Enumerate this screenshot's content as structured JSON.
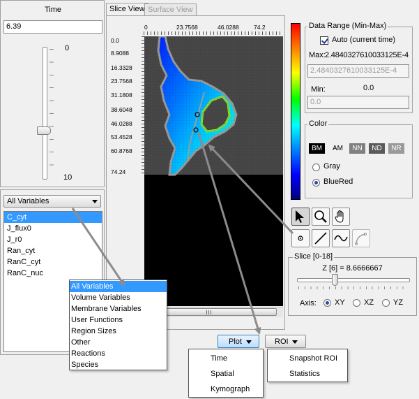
{
  "time_panel": {
    "title": "Time",
    "value": "6.39",
    "slider_max_label": "0",
    "slider_min_label": "10"
  },
  "variables": {
    "filter_selected": "All Variables",
    "list": [
      "C_cyt",
      "J_flux0",
      "J_r0",
      "Ran_cyt",
      "RanC_cyt",
      "RanC_nuc"
    ],
    "selected_index": 0,
    "filter_options": [
      "All Variables",
      "Volume Variables",
      "Membrane Variables",
      "User Functions",
      "Region Sizes",
      "Other",
      "Reactions",
      "Species"
    ]
  },
  "tabs": {
    "slice": "Slice View",
    "surface": "Surface View"
  },
  "plot_axes": {
    "x_ticks": [
      "0",
      "23.7568",
      "46.0288",
      "74.2"
    ],
    "y_ticks": [
      "0.0",
      "8.9088",
      "16.3328",
      "23.7568",
      "31.1808",
      "38.6048",
      "46.0288",
      "53.4528",
      "60.8768",
      "74.24"
    ]
  },
  "data_range": {
    "title": "Data Range (Min-Max)",
    "auto_label": "Auto (current time)",
    "auto_checked": true,
    "max_label": "Max:",
    "max_value": "2.4840327610033125E-4",
    "max_field": "2.4840327610033125E-4",
    "min_label": "Min:",
    "min_value": "0.0",
    "min_field": "0.0"
  },
  "color": {
    "title": "Color",
    "buttons": [
      "BM",
      "AM",
      "NN",
      "ND",
      "NR"
    ],
    "selected_button": "AM",
    "gray_label": "Gray",
    "bluered_label": "BlueRed",
    "selected": "BlueRed",
    "colors": {
      "bm": "#000000",
      "nn": "#808080",
      "nd": "#5a5a5a",
      "nr": "#9a9a9a"
    }
  },
  "tools": [
    "select-arrow",
    "zoom",
    "pan",
    "point",
    "line",
    "curve",
    "spline"
  ],
  "slice": {
    "title": "Slice [0-18]",
    "z_label": "Z [6] = 8.6666667",
    "axis_label": "Axis:",
    "axes": [
      "XY",
      "XZ",
      "YZ"
    ],
    "selected_axis": "XY"
  },
  "buttons": {
    "plot": "Plot",
    "roi": "ROI"
  },
  "plot_menu": [
    "Time",
    "Spatial",
    "Kymograph"
  ],
  "roi_menu": [
    "Snapshot ROI",
    "Statistics"
  ],
  "accent_color": "#3399ff"
}
